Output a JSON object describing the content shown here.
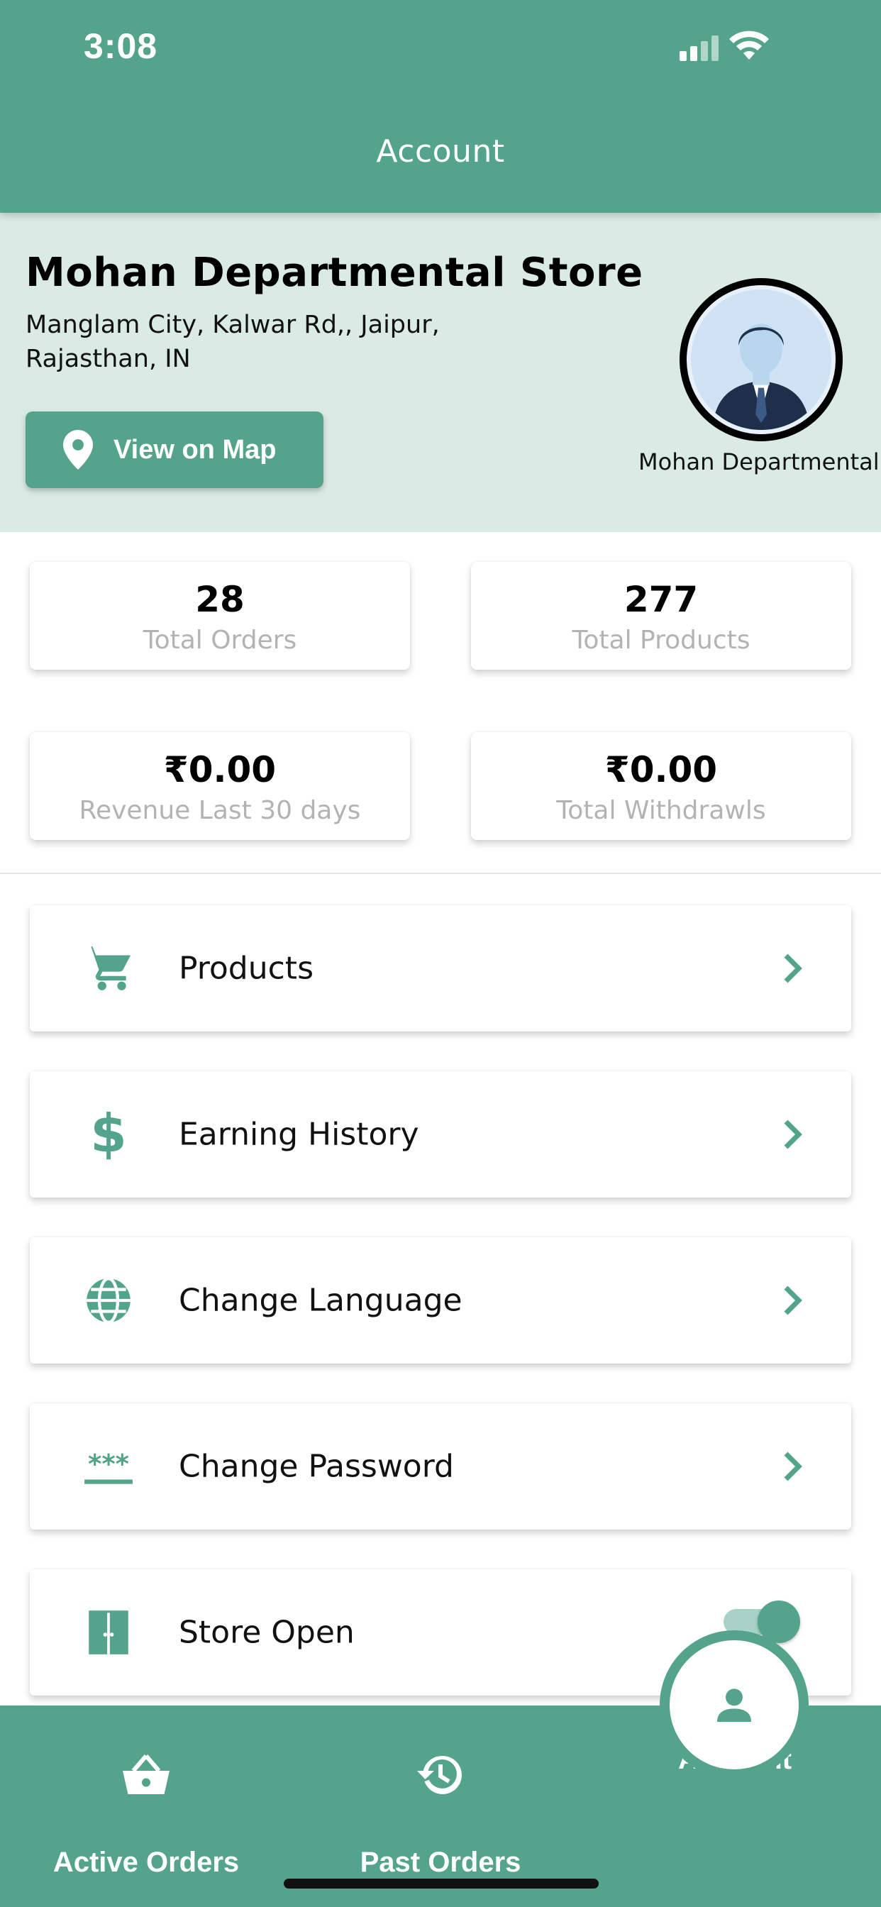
{
  "status_bar": {
    "time": "3:08"
  },
  "header": {
    "title": "Account"
  },
  "store": {
    "name": "Mohan Departmental Store",
    "address": "Manglam City, Kalwar Rd,, Jaipur, Rajasthan, IN",
    "map_button": "View on Map",
    "avatar_caption": "Mohan Departmental Store"
  },
  "stats": [
    {
      "value": "28",
      "label": "Total Orders"
    },
    {
      "value": "277",
      "label": "Total Products"
    },
    {
      "value": "₹0.00",
      "label": "Revenue Last 30 days"
    },
    {
      "value": "₹0.00",
      "label": "Total Withdrawls"
    }
  ],
  "menu": [
    {
      "label": "Products",
      "icon": "cart-icon"
    },
    {
      "label": "Earning History",
      "icon": "dollar-icon"
    },
    {
      "label": "Change Language",
      "icon": "globe-icon"
    },
    {
      "label": "Change Password",
      "icon": "password-icon"
    },
    {
      "label": "Store Open",
      "icon": "door-icon",
      "toggle_on": true
    }
  ],
  "bottom_nav": {
    "items": [
      {
        "label": "Active Orders",
        "icon": "basket-icon"
      },
      {
        "label": "Past Orders",
        "icon": "history-icon"
      },
      {
        "label": "Account",
        "icon": "person-icon",
        "active": true
      }
    ]
  },
  "colors": {
    "primary": "#54a38b",
    "store_bg": "#daeae5",
    "muted_text": "#b3b3b3"
  }
}
